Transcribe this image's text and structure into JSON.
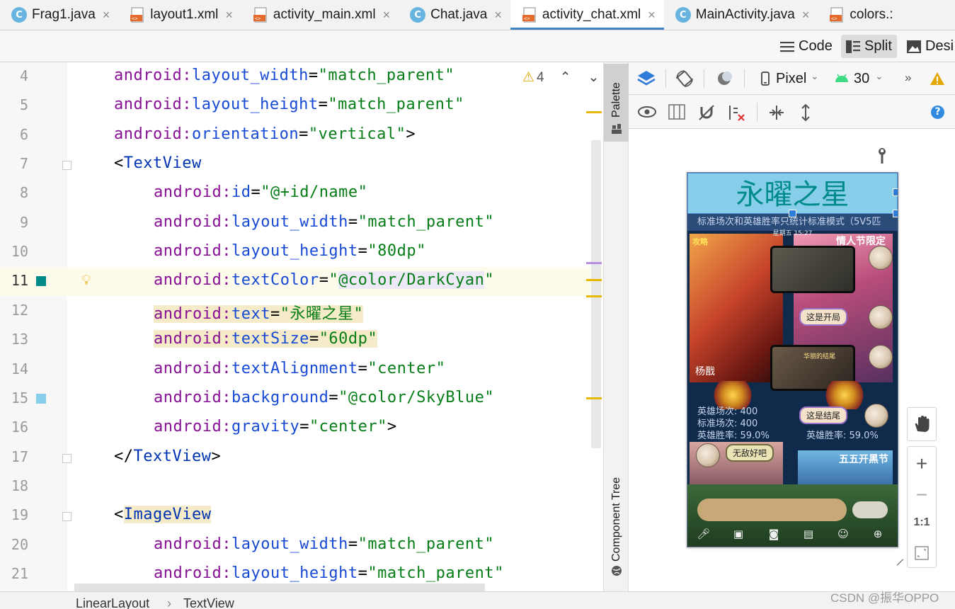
{
  "tabs": [
    {
      "label": "Frag1.java",
      "icon": "java-class-icon",
      "active": false
    },
    {
      "label": "layout1.xml",
      "icon": "xml-layout-icon",
      "active": false
    },
    {
      "label": "activity_main.xml",
      "icon": "xml-layout-icon",
      "active": false
    },
    {
      "label": "Chat.java",
      "icon": "java-class-icon",
      "active": false
    },
    {
      "label": "activity_chat.xml",
      "icon": "xml-layout-icon",
      "active": true
    },
    {
      "label": "MainActivity.java",
      "icon": "java-class-icon",
      "active": false
    },
    {
      "label": "colors.:",
      "icon": "xml-layout-icon",
      "active": false
    }
  ],
  "java_icon_letter": "C",
  "close_glyph": "×",
  "view_modes": {
    "code": "Code",
    "split": "Split",
    "design": "Desi",
    "active": "split"
  },
  "inspection": {
    "warnings": "4"
  },
  "editor_lines": [
    {
      "num": "4",
      "indent": 1,
      "parts": [
        [
          "k",
          "android:"
        ],
        [
          "a",
          "layout_width"
        ],
        [
          "p",
          "="
        ],
        [
          "s",
          "\"match_parent\""
        ]
      ]
    },
    {
      "num": "5",
      "indent": 1,
      "parts": [
        [
          "k",
          "android:"
        ],
        [
          "a",
          "layout_height"
        ],
        [
          "p",
          "="
        ],
        [
          "s",
          "\"match_parent\""
        ]
      ]
    },
    {
      "num": "6",
      "indent": 1,
      "parts": [
        [
          "k",
          "android:"
        ],
        [
          "a",
          "orientation"
        ],
        [
          "p",
          "="
        ],
        [
          "s",
          "\"vertical\""
        ],
        [
          "p",
          ">"
        ]
      ]
    },
    {
      "num": "7",
      "indent": 1,
      "parts": [
        [
          "p",
          "<"
        ],
        [
          "t",
          "TextView"
        ]
      ]
    },
    {
      "num": "8",
      "indent": 2,
      "parts": [
        [
          "k",
          "android:"
        ],
        [
          "a",
          "id"
        ],
        [
          "p",
          "="
        ],
        [
          "s",
          "\"@+id/name\""
        ]
      ]
    },
    {
      "num": "9",
      "indent": 2,
      "parts": [
        [
          "k",
          "android:"
        ],
        [
          "a",
          "layout_width"
        ],
        [
          "p",
          "="
        ],
        [
          "s",
          "\"match_parent\""
        ]
      ]
    },
    {
      "num": "10",
      "indent": 2,
      "parts": [
        [
          "k",
          "android:"
        ],
        [
          "a",
          "layout_height"
        ],
        [
          "p",
          "="
        ],
        [
          "s",
          "\"80dp\""
        ]
      ]
    },
    {
      "num": "11",
      "indent": 2,
      "parts": [
        [
          "k",
          "android:"
        ],
        [
          "a",
          "textColor"
        ],
        [
          "p",
          "="
        ],
        [
          "s",
          "\""
        ],
        [
          "s2",
          "@color/DarkCyan"
        ],
        [
          "s",
          "\""
        ]
      ]
    },
    {
      "num": "12",
      "indent": 2,
      "parts": [
        [
          "hk",
          "android:"
        ],
        [
          "ha",
          "text"
        ],
        [
          "hp",
          "="
        ],
        [
          "hs",
          "\"永曜之星\""
        ]
      ]
    },
    {
      "num": "13",
      "indent": 2,
      "parts": [
        [
          "hk",
          "android:"
        ],
        [
          "ha",
          "textSize"
        ],
        [
          "hp",
          "="
        ],
        [
          "hs",
          "\"60dp\""
        ]
      ]
    },
    {
      "num": "14",
      "indent": 2,
      "parts": [
        [
          "k",
          "android:"
        ],
        [
          "a",
          "textAlignment"
        ],
        [
          "p",
          "="
        ],
        [
          "s",
          "\"center\""
        ]
      ]
    },
    {
      "num": "15",
      "indent": 2,
      "parts": [
        [
          "k",
          "android:"
        ],
        [
          "a",
          "background"
        ],
        [
          "p",
          "="
        ],
        [
          "s",
          "\"@color/SkyBlue\""
        ]
      ]
    },
    {
      "num": "16",
      "indent": 2,
      "parts": [
        [
          "k",
          "android:"
        ],
        [
          "a",
          "gravity"
        ],
        [
          "p",
          "="
        ],
        [
          "s",
          "\"center\""
        ],
        [
          "p",
          ">"
        ]
      ]
    },
    {
      "num": "17",
      "indent": 1,
      "parts": [
        [
          "p",
          "</"
        ],
        [
          "t",
          "TextView"
        ],
        [
          "p",
          ">"
        ]
      ]
    },
    {
      "num": "18",
      "indent": 1,
      "parts": []
    },
    {
      "num": "19",
      "indent": 1,
      "parts": [
        [
          "p",
          "<"
        ],
        [
          "ht",
          "ImageView"
        ]
      ]
    },
    {
      "num": "20",
      "indent": 2,
      "parts": [
        [
          "k",
          "android:"
        ],
        [
          "a",
          "layout_width"
        ],
        [
          "p",
          "="
        ],
        [
          "s",
          "\"match_parent\""
        ]
      ]
    },
    {
      "num": "21",
      "indent": 2,
      "parts": [
        [
          "k",
          "android:"
        ],
        [
          "a",
          "layout_height"
        ],
        [
          "p",
          "="
        ],
        [
          "s",
          "\"match_parent\""
        ]
      ]
    }
  ],
  "current_line": "11",
  "color_swatches": {
    "DarkCyan": "#008b8b",
    "SkyBlue": "#87ceeb"
  },
  "side_panels": {
    "palette": "Palette",
    "component_tree": "Component Tree"
  },
  "design_toolbar": {
    "device": "Pixel",
    "api_level": "30",
    "overflow": "»"
  },
  "preview": {
    "title_text": "永曜之星",
    "banner": "标准场次和英雄胜率只统计标准模式（5V5匹",
    "date": "星期五 15:27",
    "hero_tag": "攻略",
    "hero_name": "杨戬",
    "card_title": "情人节限定",
    "bubble1": "这是开局",
    "bubble2": "这是结尾",
    "bubble3": "无敌好吧",
    "stats_left": [
      "英雄场次: 400",
      "标准场次: 400",
      "英雄胜率: 59.0%"
    ],
    "stats_right": "英雄胜率: 59.0%",
    "lower_title": "五五开黑节",
    "shot_caption": "华丽的结尾"
  },
  "zoom": {
    "plus": "+",
    "minus": "−",
    "one_to_one": "1:1"
  },
  "breadcrumb": [
    "LinearLayout",
    "TextView"
  ],
  "breadcrumb_sep": "›",
  "watermark": "CSDN @振华OPPO",
  "colors": {
    "accent": "#4083c9",
    "warning": "#e0a800"
  }
}
